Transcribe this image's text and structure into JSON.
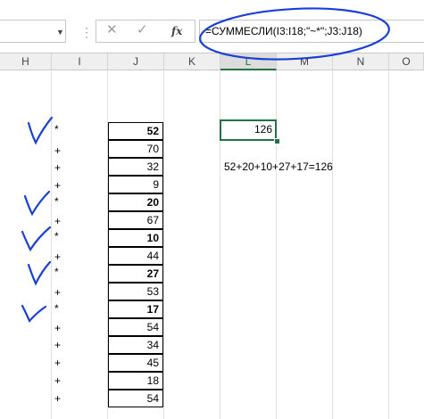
{
  "formula_bar": {
    "cancel_icon": "✕",
    "enter_icon": "✓",
    "fx_label": "fx",
    "formula": "=СУММЕСЛИ(I3:I18;\"~*\";J3:J18)"
  },
  "columns": [
    "H",
    "I",
    "J",
    "K",
    "L",
    "M",
    "N",
    "O"
  ],
  "selected_column": "L",
  "rows": [
    {
      "sign": "*",
      "value": "52",
      "bold": true,
      "checked": true
    },
    {
      "sign": "+",
      "value": "70",
      "bold": false,
      "checked": false
    },
    {
      "sign": "+",
      "value": "32",
      "bold": false,
      "checked": false
    },
    {
      "sign": "+",
      "value": "9",
      "bold": false,
      "checked": false
    },
    {
      "sign": "*",
      "value": "20",
      "bold": true,
      "checked": true
    },
    {
      "sign": "+",
      "value": "67",
      "bold": false,
      "checked": false
    },
    {
      "sign": "*",
      "value": "10",
      "bold": true,
      "checked": true
    },
    {
      "sign": "+",
      "value": "44",
      "bold": false,
      "checked": false
    },
    {
      "sign": "*",
      "value": "27",
      "bold": true,
      "checked": true
    },
    {
      "sign": "+",
      "value": "53",
      "bold": false,
      "checked": false
    },
    {
      "sign": "*",
      "value": "17",
      "bold": true,
      "checked": true
    },
    {
      "sign": "+",
      "value": "54",
      "bold": false,
      "checked": false
    },
    {
      "sign": "+",
      "value": "34",
      "bold": false,
      "checked": false
    },
    {
      "sign": "+",
      "value": "45",
      "bold": false,
      "checked": false
    },
    {
      "sign": "+",
      "value": "18",
      "bold": false,
      "checked": false
    },
    {
      "sign": "+",
      "value": "54",
      "bold": false,
      "checked": false
    }
  ],
  "result_cell": "126",
  "sum_note": "52+20+10+27+17=126",
  "colors": {
    "selection": "#217346",
    "annotation": "#1a3fd6"
  }
}
